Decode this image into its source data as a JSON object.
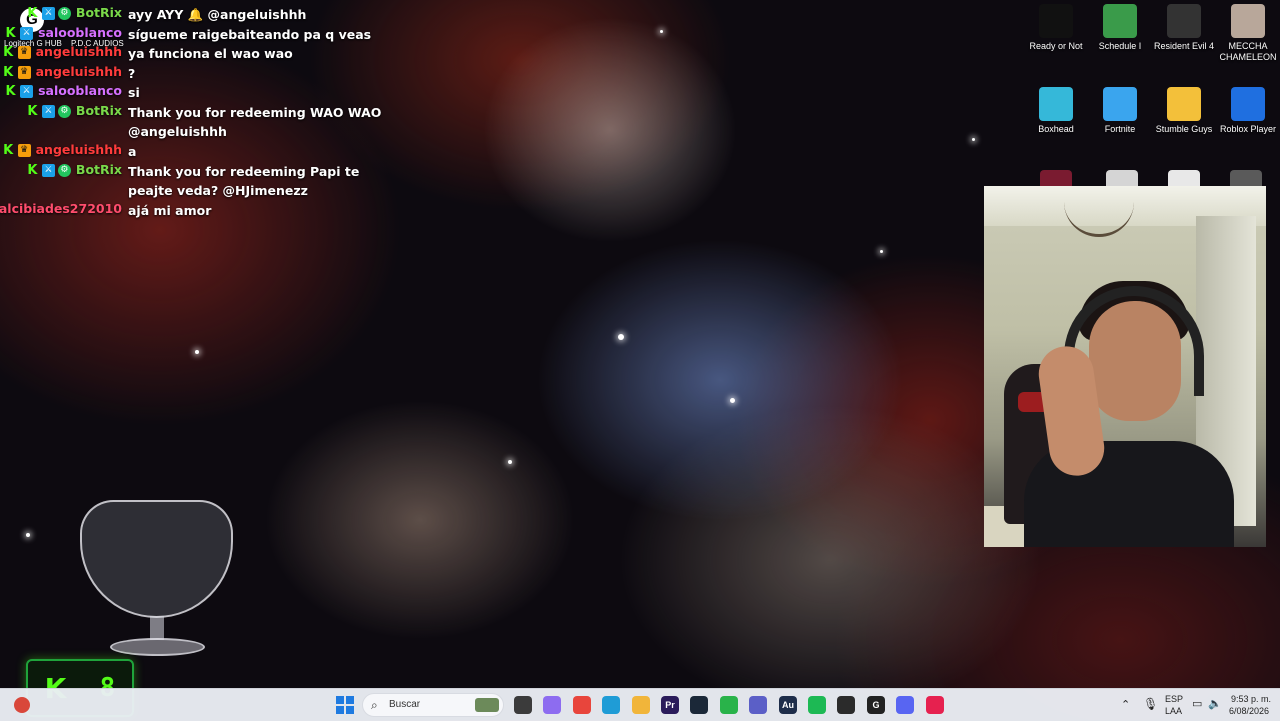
{
  "chat": {
    "messages": [
      {
        "user": "BotRix",
        "color": "#7ad94a",
        "badges": [
          "kick",
          "sword",
          "gear"
        ],
        "text": "ayy AYY 🔔 @angeluishhh"
      },
      {
        "user": "salooblanco",
        "color": "#d670ff",
        "badges": [
          "kick",
          "sword"
        ],
        "text": "sígueme raigebaiteando pa q veas"
      },
      {
        "user": "angeluishhh",
        "color": "#ff3c3c",
        "badges": [
          "kick",
          "crown"
        ],
        "text": "ya funciona el wao wao"
      },
      {
        "user": "angeluishhh",
        "color": "#ff3c3c",
        "badges": [
          "kick",
          "crown"
        ],
        "text": "?"
      },
      {
        "user": "salooblanco",
        "color": "#d670ff",
        "badges": [
          "kick",
          "sword"
        ],
        "text": "si"
      },
      {
        "user": "BotRix",
        "color": "#7ad94a",
        "badges": [
          "kick",
          "sword",
          "gear"
        ],
        "text": "Thank you for redeeming WAO WAO @angeluishhh"
      },
      {
        "user": "angeluishhh",
        "color": "#ff3c3c",
        "badges": [
          "kick",
          "crown"
        ],
        "text": "a"
      },
      {
        "user": "BotRix",
        "color": "#7ad94a",
        "badges": [
          "kick",
          "sword",
          "gear"
        ],
        "text": "Thank you for redeeming Papi te peajte veda? @HJimenezz"
      },
      {
        "user": "alcibiades272010",
        "color": "#ff4d6d",
        "badges": [
          "kick"
        ],
        "text": "ajá mi amor"
      }
    ]
  },
  "overlay": {
    "logitech_label": "Logitech G HUB",
    "pdc_label": "P.D.C AUDIOS",
    "counter": {
      "k": "K",
      "value": "8"
    }
  },
  "desktop_icons": [
    {
      "label": "Ready or Not",
      "color": "#111111"
    },
    {
      "label": "Schedule I",
      "color": "#3a9b4a"
    },
    {
      "label": "Resident Evil 4",
      "color": "#333333"
    },
    {
      "label": "MECCHA CHAMELEON",
      "color": "#b8a79a"
    },
    {
      "label": "Boxhead",
      "color": "#35b8d9"
    },
    {
      "label": "Fortnite",
      "color": "#3aa5ee"
    },
    {
      "label": "Stumble Guys",
      "color": "#f3c03a"
    },
    {
      "label": "Roblox Player",
      "color": "#1f6fe0"
    }
  ],
  "taskbar": {
    "search_placeholder": "Buscar",
    "apps": [
      {
        "name": "file-explorer-dark",
        "color": "#3b3b3b",
        "glyph": ""
      },
      {
        "name": "copilot",
        "color": "#8d6cf0",
        "glyph": ""
      },
      {
        "name": "chrome",
        "color": "#e8453c",
        "glyph": ""
      },
      {
        "name": "edge",
        "color": "#1f9cd6",
        "glyph": ""
      },
      {
        "name": "folder",
        "color": "#f1b53a",
        "glyph": ""
      },
      {
        "name": "premiere",
        "color": "#2a1b5a",
        "glyph": "Pr"
      },
      {
        "name": "steam",
        "color": "#1b2838",
        "glyph": ""
      },
      {
        "name": "green-app",
        "color": "#29b34a",
        "glyph": ""
      },
      {
        "name": "teams",
        "color": "#5b5fc7",
        "glyph": ""
      },
      {
        "name": "audition",
        "color": "#1e2d4a",
        "glyph": "Au"
      },
      {
        "name": "spotify",
        "color": "#1db954",
        "glyph": ""
      },
      {
        "name": "obs",
        "color": "#2b2b2b",
        "glyph": ""
      },
      {
        "name": "g-app",
        "color": "#222222",
        "glyph": "G"
      },
      {
        "name": "discord",
        "color": "#5865f2",
        "glyph": ""
      },
      {
        "name": "tiktok",
        "color": "#e6214f",
        "glyph": ""
      }
    ],
    "tray": {
      "language_top": "ESP",
      "language_bottom": "LAA",
      "time": "9:53 p. m.",
      "date": "6/08/2026"
    }
  }
}
